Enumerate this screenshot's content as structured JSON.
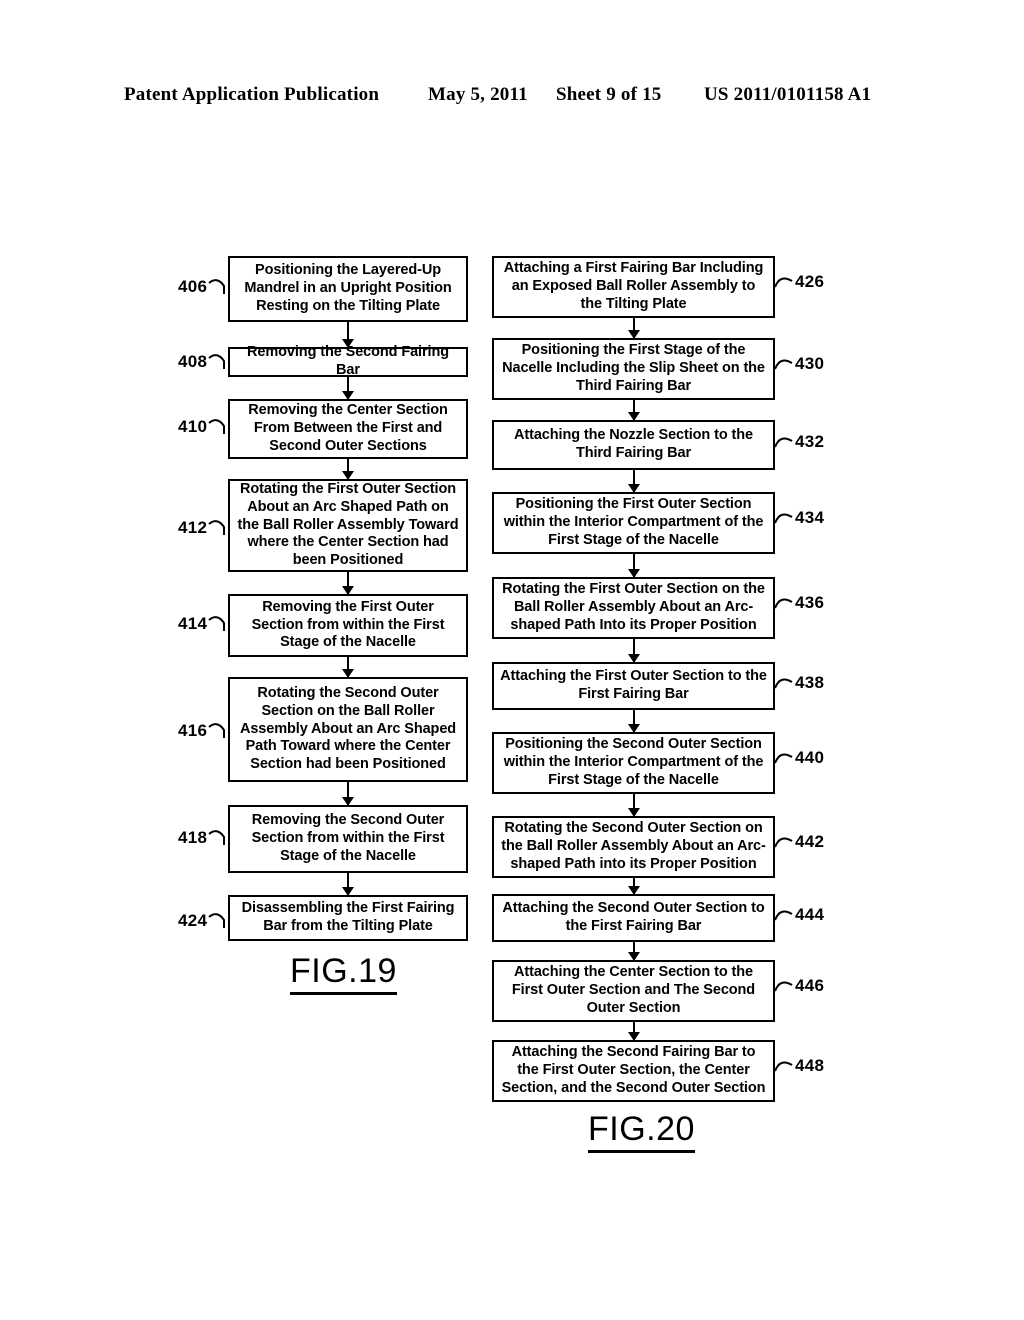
{
  "header": {
    "publication": "Patent Application Publication",
    "date": "May 5, 2011",
    "sheet": "Sheet 9 of 15",
    "patent_number": "US 2011/0101158 A1"
  },
  "figures": [
    {
      "caption": "FIG.19",
      "nodes": [
        {
          "ref": "406",
          "text": "Positioning the Layered-Up Mandrel in an Upright Position Resting on the Tilting Plate"
        },
        {
          "ref": "408",
          "text": "Removing the Second Fairing Bar"
        },
        {
          "ref": "410",
          "text": "Removing the Center Section From Between the First and Second Outer Sections"
        },
        {
          "ref": "412",
          "text": "Rotating the First Outer Section About an Arc Shaped Path on the Ball Roller Assembly Toward where the Center Section had been Positioned"
        },
        {
          "ref": "414",
          "text": "Removing the First Outer Section from within the First Stage of the Nacelle"
        },
        {
          "ref": "416",
          "text": "Rotating the Second Outer Section on the Ball Roller Assembly About an Arc Shaped Path Toward where the Center Section had been Positioned"
        },
        {
          "ref": "418",
          "text": "Removing the Second Outer Section from within the First Stage of the Nacelle"
        },
        {
          "ref": "424",
          "text": "Disassembling the First Fairing Bar from the Tilting Plate"
        }
      ]
    },
    {
      "caption": "FIG.20",
      "nodes": [
        {
          "ref": "426",
          "text": "Attaching a First Fairing Bar Including an Exposed Ball Roller Assembly to the Tilting Plate"
        },
        {
          "ref": "430",
          "text": "Positioning the First Stage of the Nacelle Including the Slip Sheet on the Third Fairing Bar"
        },
        {
          "ref": "432",
          "text": "Attaching the Nozzle Section to the Third Fairing Bar"
        },
        {
          "ref": "434",
          "text": "Positioning the First Outer Section within the Interior Compartment of the First Stage of the Nacelle"
        },
        {
          "ref": "436",
          "text": "Rotating the First Outer Section on the Ball Roller Assembly About an Arc-shaped Path Into its Proper Position"
        },
        {
          "ref": "438",
          "text": "Attaching the First Outer Section to the First Fairing Bar"
        },
        {
          "ref": "440",
          "text": "Positioning the Second Outer Section within the Interior Compartment of the First Stage of the Nacelle"
        },
        {
          "ref": "442",
          "text": "Rotating the Second Outer Section on the Ball Roller Assembly About an Arc-shaped Path into its Proper Position"
        },
        {
          "ref": "444",
          "text": "Attaching the Second Outer Section to the First Fairing Bar"
        },
        {
          "ref": "446",
          "text": "Attaching the Center Section to the First Outer Section and The Second Outer Section"
        },
        {
          "ref": "448",
          "text": "Attaching the Second Fairing Bar to the First Outer Section, the Center Section, and the Second Outer Section"
        }
      ]
    }
  ]
}
